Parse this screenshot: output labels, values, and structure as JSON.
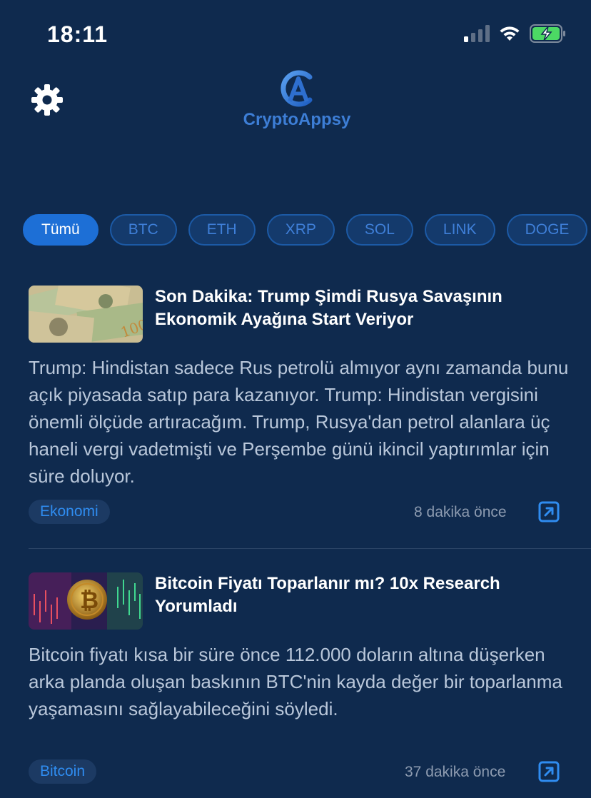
{
  "status_bar": {
    "time": "18:11"
  },
  "header": {
    "logo_text": "CryptoAppsy"
  },
  "filters": [
    "Tümü",
    "BTC",
    "ETH",
    "XRP",
    "SOL",
    "LINK",
    "DOGE"
  ],
  "news": [
    {
      "title": "Son Dakika: Trump Şimdi Rusya Savaşının Ekonomik Ayağına Start Veriyor",
      "body": "Trump: Hindistan sadece Rus petrolü almıyor aynı zamanda bunu açık piyasada satıp para kazanıyor. Trump: Hindistan vergisini önemli ölçüde artıracağım. Trump, Rusya'dan petrol alanlara üç haneli vergi vadetmişti ve Perşembe günü ikincil yaptırımlar için süre doluyor.",
      "tag": "Ekonomi",
      "time": "8 dakika önce"
    },
    {
      "title": "Bitcoin Fiyatı Toparlanır mı? 10x Research Yorumladı",
      "body": "Bitcoin fiyatı kısa bir süre önce 112.000 doların altına düşerken arka planda oluşan baskının BTC'nin kayda değer bir toparlanma yaşamasını sağlayabileceğini söyledi.",
      "tag": "Bitcoin",
      "time": "37 dakika önce"
    }
  ]
}
